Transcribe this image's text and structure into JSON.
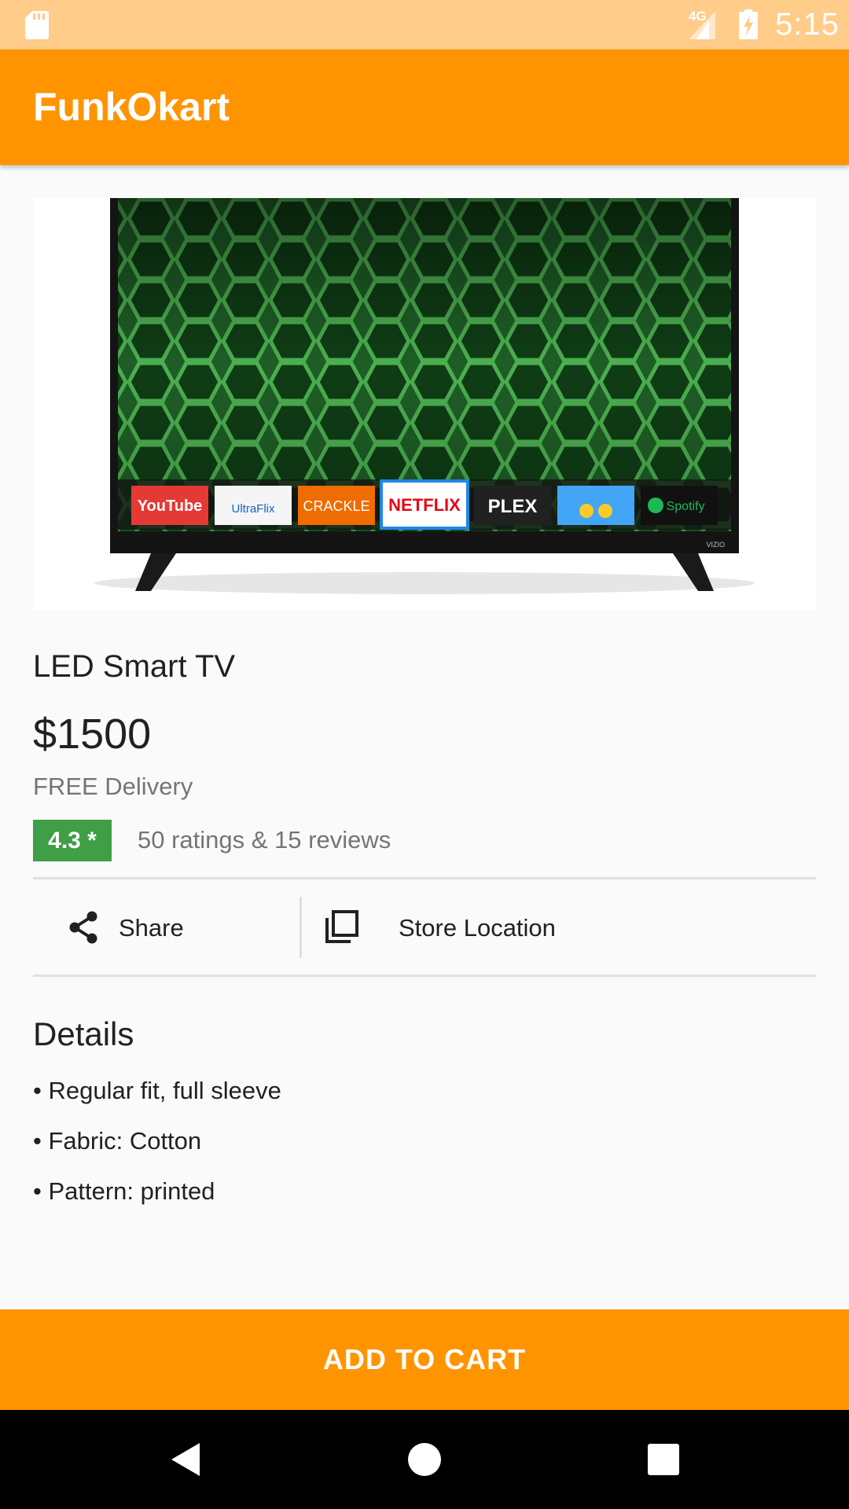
{
  "status_bar": {
    "time": "5:15",
    "network_type": "4G",
    "icons": [
      "sd-card-icon",
      "signal-icon",
      "battery-charging-icon"
    ]
  },
  "app_bar": {
    "title": "FunkOkart"
  },
  "product": {
    "image": {
      "description_icon": "led-smart-tv-image",
      "app_tiles": [
        "YouTube",
        "UltraFlix",
        "CRACKLE",
        "NETFLIX",
        "PLEX",
        "",
        "Spotify"
      ],
      "brand": "VIZIO"
    },
    "name": "LED Smart TV",
    "price": "$1500",
    "delivery": "FREE Delivery",
    "rating": "4.3 *",
    "rating_summary": "50 ratings & 15 reviews"
  },
  "actions": {
    "share_label": "Share",
    "store_label": "Store Location"
  },
  "details": {
    "heading": "Details",
    "items": [
      "• Regular fit, full sleeve",
      "• Fabric: Cotton",
      "• Pattern: printed"
    ]
  },
  "cart": {
    "label": "ADD TO CART"
  },
  "colors": {
    "accent": "#ff9400",
    "status_bar": "#ffcc8a",
    "rating_badge": "#3f9e46"
  }
}
